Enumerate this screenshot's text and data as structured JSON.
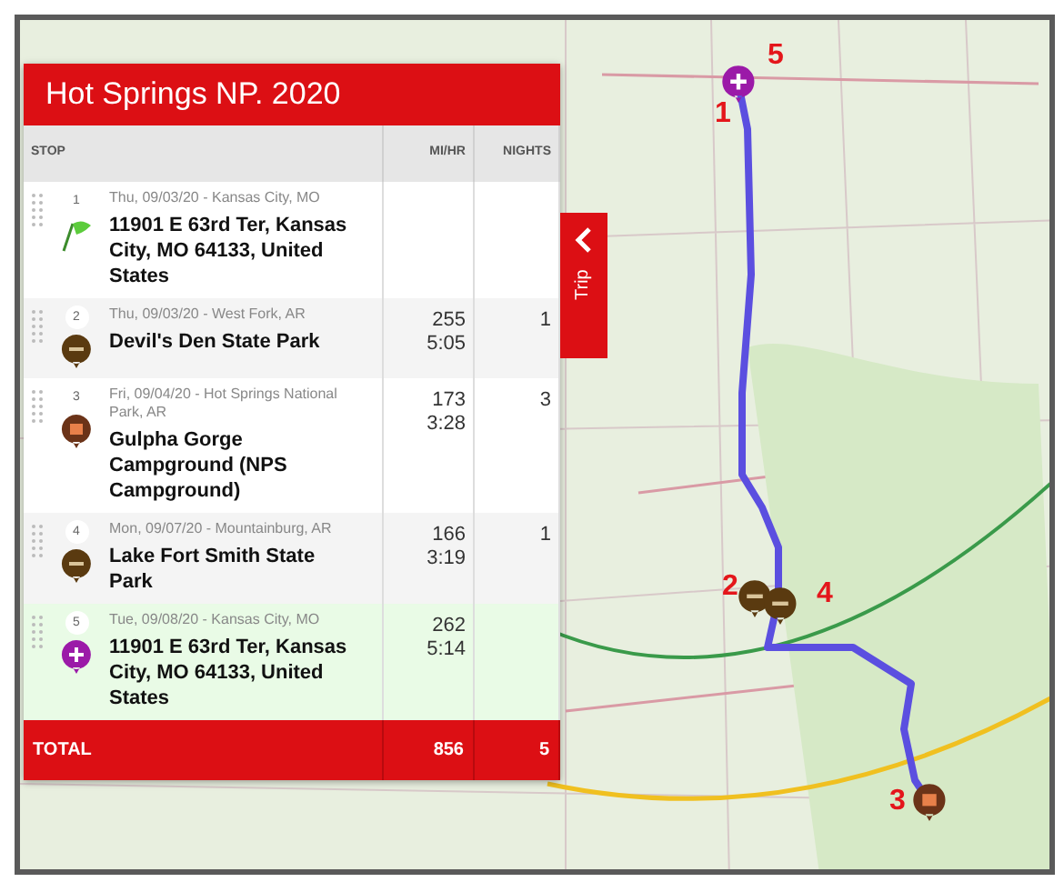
{
  "trip": {
    "title": "Hot Springs NP. 2020",
    "columns": [
      "STOP",
      "MI/HR",
      "NIGHTS"
    ],
    "stops": [
      {
        "number": "1",
        "kind": "start",
        "date_place": "Thu, 09/03/20 - Kansas City, MO",
        "name": "11901 E 63rd Ter, Kansas City, MO 64133, United States",
        "selected": false
      },
      {
        "number": "2",
        "kind": "park",
        "date_place": "Thu, 09/03/20 - West Fork, AR",
        "name": "Devil's Den State Park",
        "miles": "255",
        "hours": "5:05",
        "nights": "1",
        "selected": false
      },
      {
        "number": "3",
        "kind": "campground",
        "date_place": "Fri, 09/04/20 - Hot Springs National Park, AR",
        "name": "Gulpha Gorge Campground (NPS Campground)",
        "miles": "173",
        "hours": "3:28",
        "nights": "3",
        "selected": false
      },
      {
        "number": "4",
        "kind": "park",
        "date_place": "Mon, 09/07/20 - Mountainburg, AR",
        "name": "Lake Fort Smith State Park",
        "miles": "166",
        "hours": "3:19",
        "nights": "1",
        "selected": false
      },
      {
        "number": "5",
        "kind": "end",
        "date_place": "Tue, 09/08/20 - Kansas City, MO",
        "name": "11901 E 63rd Ter, Kansas City, MO 64133, United States",
        "miles": "262",
        "hours": "5:14",
        "selected": true
      }
    ],
    "total": {
      "label": "TOTAL",
      "miles": "856",
      "nights": "5"
    }
  },
  "trip_tab": {
    "label": "Trip"
  },
  "map_markers": [
    {
      "label": "5",
      "kind": "end"
    },
    {
      "label": "1",
      "kind": "none"
    },
    {
      "label": "2",
      "kind": "park"
    },
    {
      "label": "4",
      "kind": "park"
    },
    {
      "label": "3",
      "kind": "campground"
    }
  ]
}
